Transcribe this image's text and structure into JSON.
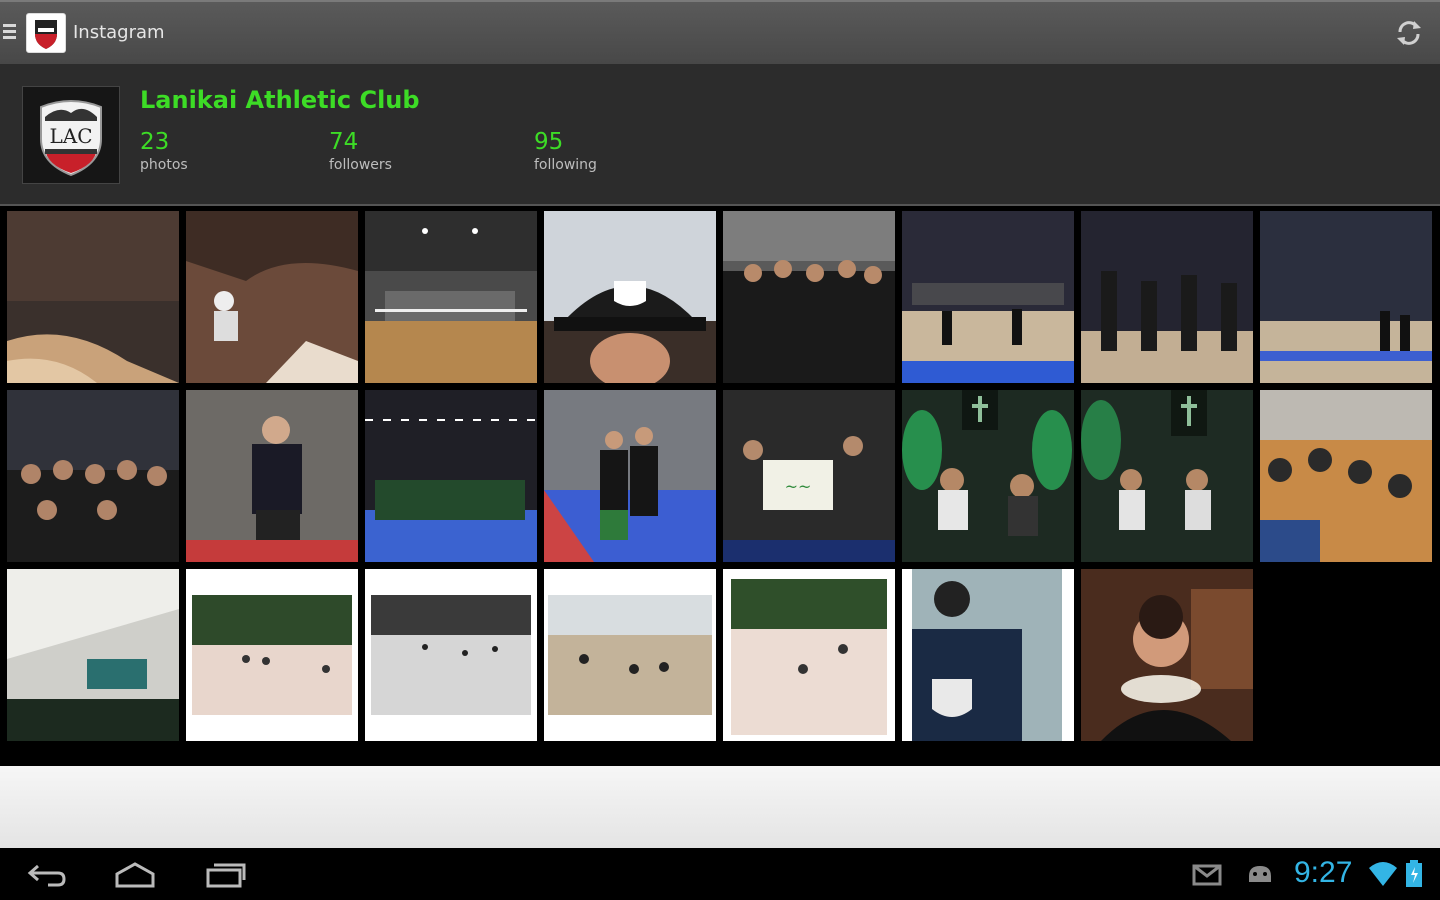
{
  "app": {
    "title": "Instagram"
  },
  "profile": {
    "name": "Lanikai Athletic Club",
    "stats": {
      "photos": {
        "value": "23",
        "label": "photos"
      },
      "followers": {
        "value": "74",
        "label": "followers"
      },
      "following": {
        "value": "95",
        "label": "following"
      }
    }
  },
  "grid": {
    "photos": [
      {
        "subject": "canyon-cliff"
      },
      {
        "subject": "person-on-rock"
      },
      {
        "subject": "volleyball-gym"
      },
      {
        "subject": "selfie-cap"
      },
      {
        "subject": "team-photo"
      },
      {
        "subject": "volleyball-court"
      },
      {
        "subject": "team-celebration"
      },
      {
        "subject": "convention-courts"
      },
      {
        "subject": "team-group"
      },
      {
        "subject": "coach-sitting"
      },
      {
        "subject": "court-hall"
      },
      {
        "subject": "family-on-court"
      },
      {
        "subject": "group-with-sign"
      },
      {
        "subject": "musicians-stage"
      },
      {
        "subject": "musicians-stage-2"
      },
      {
        "subject": "team-on-floor"
      },
      {
        "subject": "banquet-hall"
      },
      {
        "subject": "beach-group"
      },
      {
        "subject": "beach-bw"
      },
      {
        "subject": "beach-workout"
      },
      {
        "subject": "beach-drill"
      },
      {
        "subject": "shirt-back"
      },
      {
        "subject": "woman-lei"
      }
    ]
  },
  "status": {
    "time": "9:27",
    "accent_color": "#33b5e5"
  },
  "colors": {
    "profile_green": "#3ddc26"
  }
}
